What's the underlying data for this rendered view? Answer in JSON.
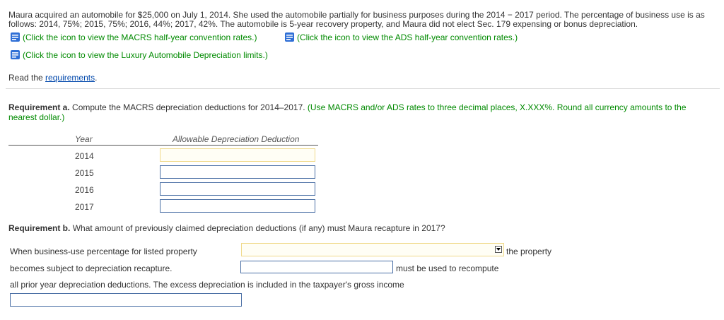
{
  "intro": {
    "line1": "Maura acquired an automobile for $25,000 on July 1, 2014. She used the automobile partially for business purposes during the 2014 − 2017 period. The percentage of business use is as",
    "line2": "follows: 2014, 75%; 2015, 75%; 2016, 44%; 2017, 42%. The automobile is 5-year recovery property, and Maura did not elect Sec. 179 expensing or bonus depreciation."
  },
  "links": {
    "macrs": "(Click the icon to view the MACRS half-year convention rates.)",
    "ads": "(Click the icon to view the ADS half-year convention rates.)",
    "luxury": "(Click the icon to view the Luxury Automobile Depreciation limits.)"
  },
  "read": {
    "prefix": "Read the ",
    "link": "requirements",
    "suffix": "."
  },
  "req_a": {
    "label": "Requirement a.",
    "text": " Compute the MACRS depreciation deductions for 2014–2017.",
    "hint_line1": " (Use MACRS and/or ADS rates to three decimal places, X.XXX%. Round all currency amounts to the",
    "hint_line2": "nearest dollar.)"
  },
  "table": {
    "col_year": "Year",
    "col_deduction": "Allowable Depreciation Deduction",
    "rows": [
      {
        "year": "2014",
        "value": ""
      },
      {
        "year": "2015",
        "value": ""
      },
      {
        "year": "2016",
        "value": ""
      },
      {
        "year": "2017",
        "value": ""
      }
    ]
  },
  "req_b": {
    "label": "Requirement b.",
    "text": " What amount of previously claimed depreciation deductions (if any) must Maura recapture in 2017?"
  },
  "sentence": {
    "part1": "When business-use percentage for listed property",
    "part2": "the property",
    "part3": "becomes subject to depreciation recapture.",
    "part4": "must be used to recompute",
    "part5": "all prior year depreciation deductions. The excess depreciation is included in the taxpayer's gross income"
  },
  "colors": {
    "green": "#008a00",
    "link_blue": "#0047ab",
    "input_border": "#4a6fa5",
    "active_border": "#f0d98a"
  },
  "icons": {
    "info": "document-info-icon"
  }
}
